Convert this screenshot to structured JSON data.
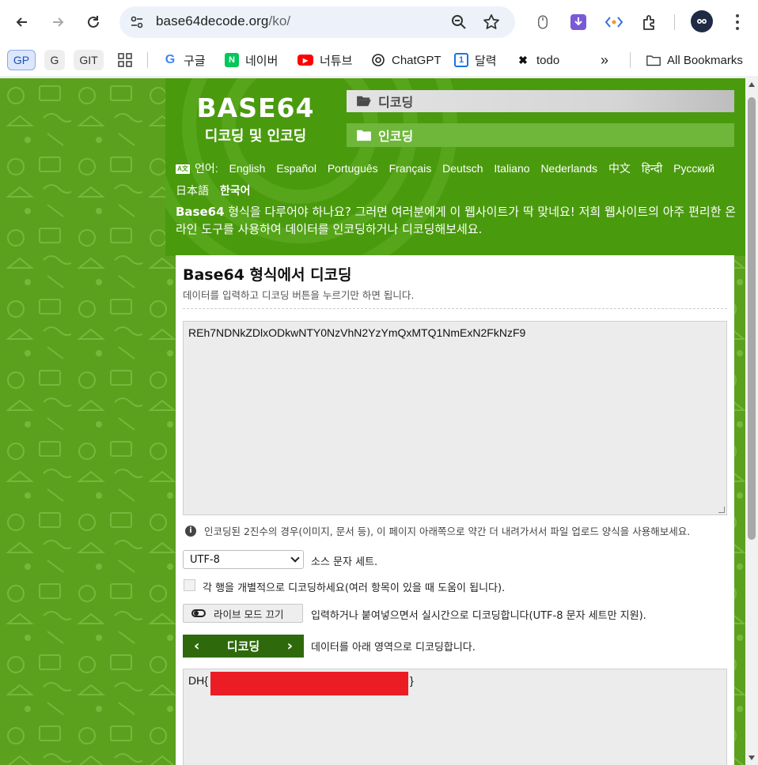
{
  "browser": {
    "url_host": "base64decode.org",
    "url_path": "/ko/",
    "bookmarks": {
      "chips": [
        "GP",
        "G",
        "GIT"
      ],
      "items": [
        {
          "label": "구글",
          "icon": "google-icon"
        },
        {
          "label": "네이버",
          "icon": "naver-icon"
        },
        {
          "label": "너튜브",
          "icon": "youtube-icon"
        },
        {
          "label": "ChatGPT",
          "icon": "chatgpt-icon"
        },
        {
          "label": "달력",
          "icon": "calendar-icon"
        },
        {
          "label": "todo",
          "icon": "todo-icon"
        }
      ],
      "more": "»",
      "all_bookmarks": "All Bookmarks"
    }
  },
  "site": {
    "logo_title": "BASE64",
    "logo_subtitle": "디코딩 및 인코딩",
    "tab_decode": "디코딩",
    "tab_encode": "인코딩",
    "language_label": "언어:",
    "languages": [
      "English",
      "Español",
      "Português",
      "Français",
      "Deutsch",
      "Italiano",
      "Nederlands",
      "中文",
      "हिन्दी",
      "Русский",
      "日本語",
      "한국어"
    ],
    "intro_bold": "Base64",
    "intro_rest": " 형식을 다루어야 하나요? 그러면 여러분에게 이 웹사이트가 딱 맞네요! 저희 웹사이트의 아주 편리한 온라인 도구를 사용하여 데이터를 인코딩하거나 디코딩해보세요."
  },
  "form": {
    "title": "Base64 형식에서 디코딩",
    "description": "데이터를 입력하고 디코딩 버튼을 누르기만 하면 됩니다.",
    "input_value": "REh7NDNkZDlxODkwNTY0NzVhN2YzYmQxMTQ1NmExN2FkNzF9",
    "info_text": "인코딩된 2진수의 경우(이미지, 문서 등), 이 페이지 아래쪽으로 약간 더 내려가서서 파일 업로드 양식을 사용해보세요.",
    "charset_value": "UTF-8",
    "charset_label": "소스 문자 세트.",
    "separate_lines_label": "각 행을 개별적으로 디코딩하세요(여러 항목이 있을 때 도움이 됩니다).",
    "live_mode_button": "라이브 모드 끄기",
    "live_mode_label": "입력하거나 붙여넣으면서 실시간으로 디코딩합니다(UTF-8 문자 세트만 지원).",
    "decode_button": "디코딩",
    "decode_label": "데이터를 아래 영역으로 디코딩합니다.",
    "output_prefix": "DH{",
    "output_suffix": "}"
  },
  "colors": {
    "page_green": "#5ba11e",
    "header_green": "#4a9a0e",
    "button_dark_green": "#2e6a0c",
    "redaction_red": "#ec1c24"
  }
}
